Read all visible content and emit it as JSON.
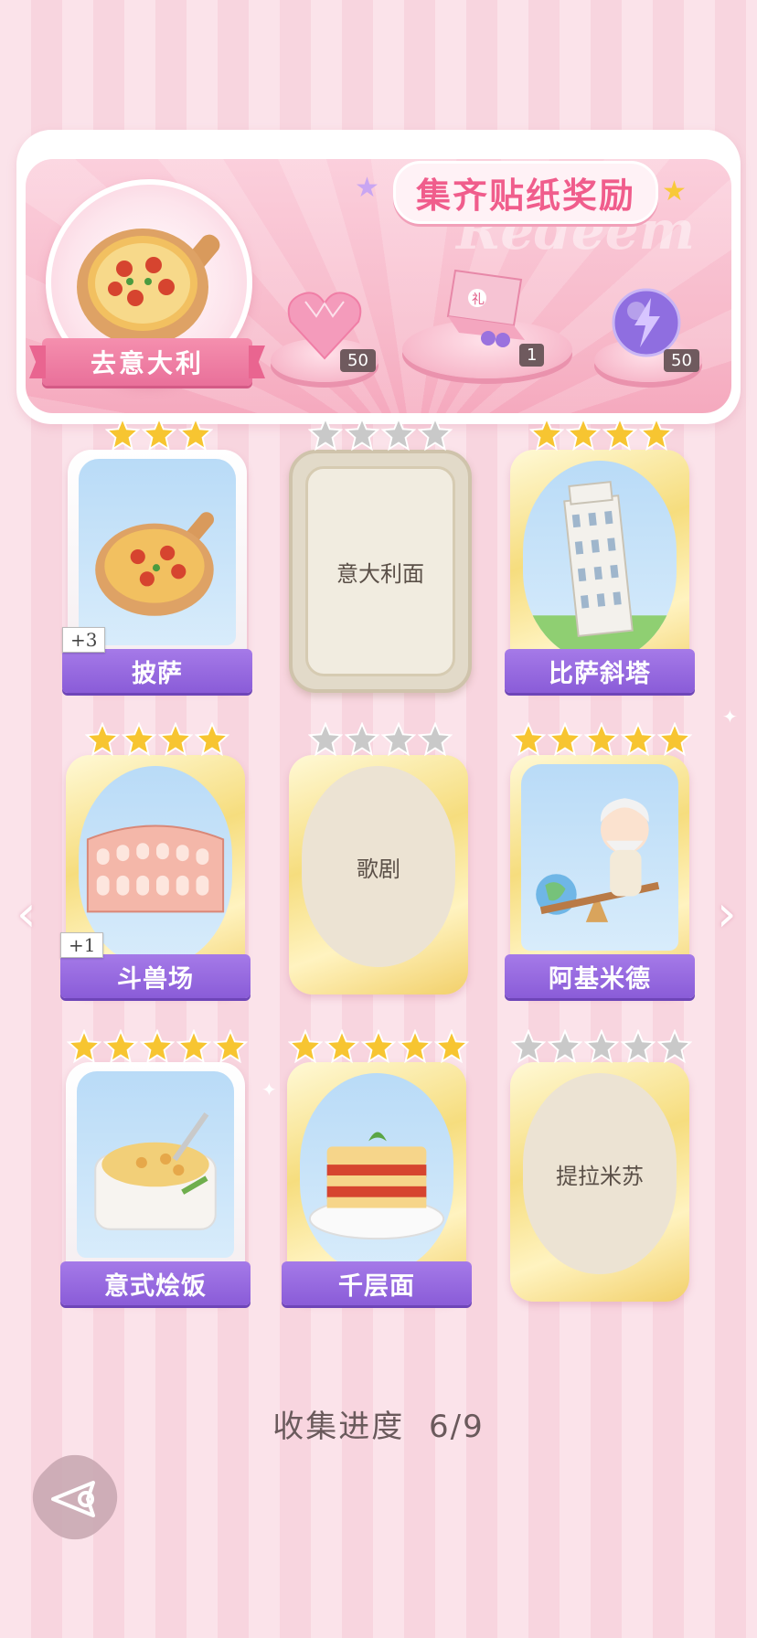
{
  "banner": {
    "title": "集齐贴纸奖励",
    "watermark": "Redeem",
    "destination": "去意大利",
    "rewards": [
      {
        "name": "heart-gem-icon",
        "count": "50"
      },
      {
        "name": "gift-box-icon",
        "count": "1"
      },
      {
        "name": "energy-orb-icon",
        "count": "50"
      }
    ]
  },
  "cards": [
    {
      "label": "披萨",
      "state": "unlocked",
      "stars": 3,
      "extra": "+3",
      "art": "pizza"
    },
    {
      "label": "意大利面",
      "state": "locked",
      "stars": 4,
      "art": "none"
    },
    {
      "label": "比萨斜塔",
      "state": "unlocked",
      "stars": 4,
      "art": "tower"
    },
    {
      "label": "斗兽场",
      "state": "unlocked",
      "stars": 4,
      "extra": "+1",
      "art": "colosseum"
    },
    {
      "label": "歌剧",
      "state": "locked",
      "stars": 4,
      "art": "none"
    },
    {
      "label": "阿基米德",
      "state": "unlocked",
      "stars": 5,
      "art": "archimedes"
    },
    {
      "label": "意式烩饭",
      "state": "unlocked",
      "stars": 5,
      "art": "risotto"
    },
    {
      "label": "千层面",
      "state": "unlocked",
      "stars": 5,
      "art": "lasagna"
    },
    {
      "label": "提拉米苏",
      "state": "locked",
      "stars": 5,
      "art": "none"
    }
  ],
  "progress": {
    "label": "收集进度",
    "value": "6/9"
  },
  "nav": {
    "prev": "‹",
    "next": "›"
  },
  "colors": {
    "star_gold": "#f7c531",
    "star_gray": "#c9c9c9",
    "ribbon_purple": "#9566dd"
  }
}
